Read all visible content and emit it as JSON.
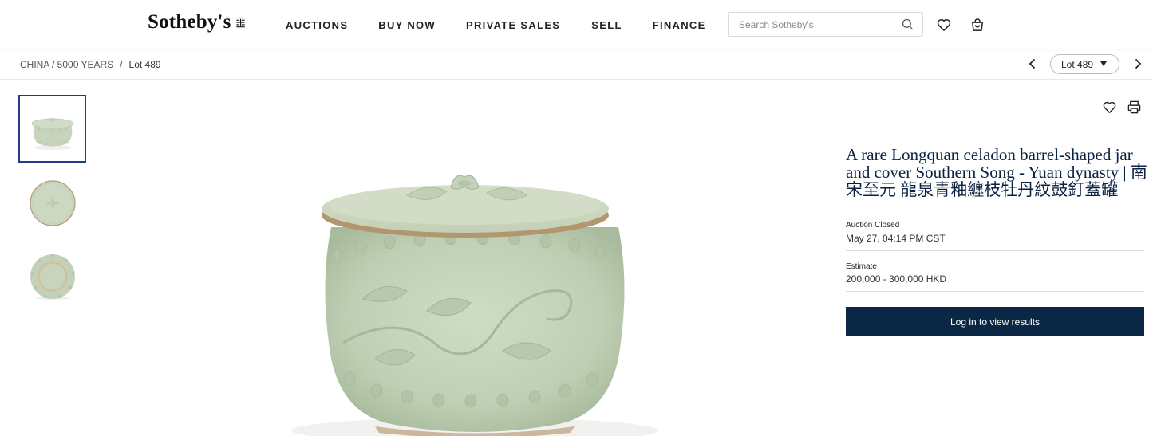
{
  "header": {
    "logo_text": "Sotheby's",
    "logo_mark": "EST 1744",
    "nav": [
      "AUCTIONS",
      "BUY NOW",
      "PRIVATE SALES",
      "SELL",
      "FINANCE"
    ],
    "search_placeholder": "Search Sotheby's",
    "icons": [
      "search-icon",
      "heart-icon",
      "shopping-bag-icon"
    ]
  },
  "breadcrumb": {
    "parent": "CHINA / 5000 YEARS",
    "separator": "/",
    "current": "Lot 489"
  },
  "lot_nav": {
    "selected": "Lot 489",
    "icons": [
      "chevron-left-icon",
      "caret-down-icon",
      "chevron-right-icon"
    ]
  },
  "gallery": {
    "thumbnails": [
      "jar-side-view",
      "jar-top-view",
      "jar-base-view"
    ],
    "selected_index": 0
  },
  "lot": {
    "title": "A rare Longquan celadon barrel-shaped jar and cover Southern Song - Yuan dynasty | 南宋至元 龍泉青釉纏枝牡丹紋鼓釘蓋罐",
    "status_label": "Auction Closed",
    "status_value": "May 27, 04:14 PM CST",
    "estimate_label": "Estimate",
    "estimate_value": "200,000 - 300,000 HKD",
    "cta_label": "Log in to view results",
    "action_icons": [
      "heart-icon",
      "printer-icon"
    ]
  },
  "colors": {
    "navy": "#0a2846",
    "title_text": "#0b2343",
    "active_thumb_border": "#1f3c88",
    "celadon": "#c9d6be"
  }
}
